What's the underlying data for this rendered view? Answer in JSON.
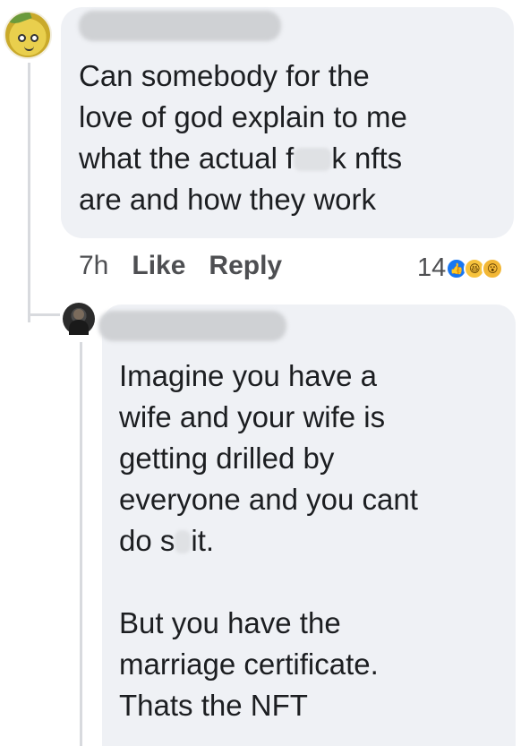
{
  "comment": {
    "lines": [
      "Can somebody for the",
      "love of god explain to me",
      "what the actual f",
      "k nfts",
      "are and how they work"
    ],
    "time": "7h",
    "like_label": "Like",
    "reply_label": "Reply",
    "reaction_count": "14",
    "reactions": [
      "like-icon",
      "haha-icon",
      "wow-icon"
    ],
    "avatar": "jake-the-dog-avatar"
  },
  "reply": {
    "lines": [
      "Imagine you have a",
      "wife and your wife is",
      "getting drilled by",
      "everyone and you cant",
      "do s",
      "it.",
      "But you have the",
      "marriage certificate.",
      "Thats the NFT"
    ],
    "avatar": "user-avatar"
  },
  "colors": {
    "bubble": "#eff1f5",
    "text": "#1c1e21",
    "meta": "#4e4f52",
    "like_blue": "#1877f2"
  }
}
